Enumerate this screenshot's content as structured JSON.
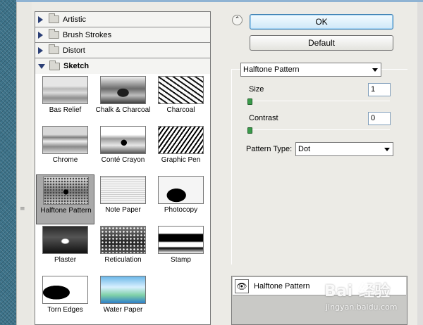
{
  "gallery": {
    "categories": [
      {
        "label": "Artistic",
        "expanded": false
      },
      {
        "label": "Brush Strokes",
        "expanded": false
      },
      {
        "label": "Distort",
        "expanded": false
      },
      {
        "label": "Sketch",
        "expanded": true
      }
    ],
    "filters": [
      {
        "label": "Bas Relief",
        "icon": "bas-relief-thumb"
      },
      {
        "label": "Chalk & Charcoal",
        "icon": "chalk-charcoal-thumb"
      },
      {
        "label": "Charcoal",
        "icon": "charcoal-thumb"
      },
      {
        "label": "Chrome",
        "icon": "chrome-thumb"
      },
      {
        "label": "Conté Crayon",
        "icon": "conte-crayon-thumb"
      },
      {
        "label": "Graphic Pen",
        "icon": "graphic-pen-thumb"
      },
      {
        "label": "Halftone Pattern",
        "icon": "halftone-pattern-thumb",
        "selected": true
      },
      {
        "label": "Note Paper",
        "icon": "note-paper-thumb"
      },
      {
        "label": "Photocopy",
        "icon": "photocopy-thumb"
      },
      {
        "label": "Plaster",
        "icon": "plaster-thumb"
      },
      {
        "label": "Reticulation",
        "icon": "reticulation-thumb"
      },
      {
        "label": "Stamp",
        "icon": "stamp-thumb"
      },
      {
        "label": "Torn Edges",
        "icon": "torn-edges-thumb"
      },
      {
        "label": "Water Paper",
        "icon": "water-paper-thumb"
      }
    ]
  },
  "buttons": {
    "ok": "OK",
    "default": "Default"
  },
  "settings": {
    "filter_select": "Halftone Pattern",
    "size_label": "Size",
    "size_value": "1",
    "size_level": 0,
    "contrast_label": "Contrast",
    "contrast_value": "0",
    "contrast_level": 0,
    "pattern_type_label": "Pattern Type:",
    "pattern_type_value": "Dot"
  },
  "layers": {
    "active_layer": "Halftone Pattern"
  },
  "watermark": {
    "brand": "Bai  经验",
    "url": "jingyan.baidu.com"
  },
  "colors": {
    "accent": "#3c7fb1",
    "slider_thumb": "#3a9a4a",
    "preview_bg": "#3c7289"
  }
}
